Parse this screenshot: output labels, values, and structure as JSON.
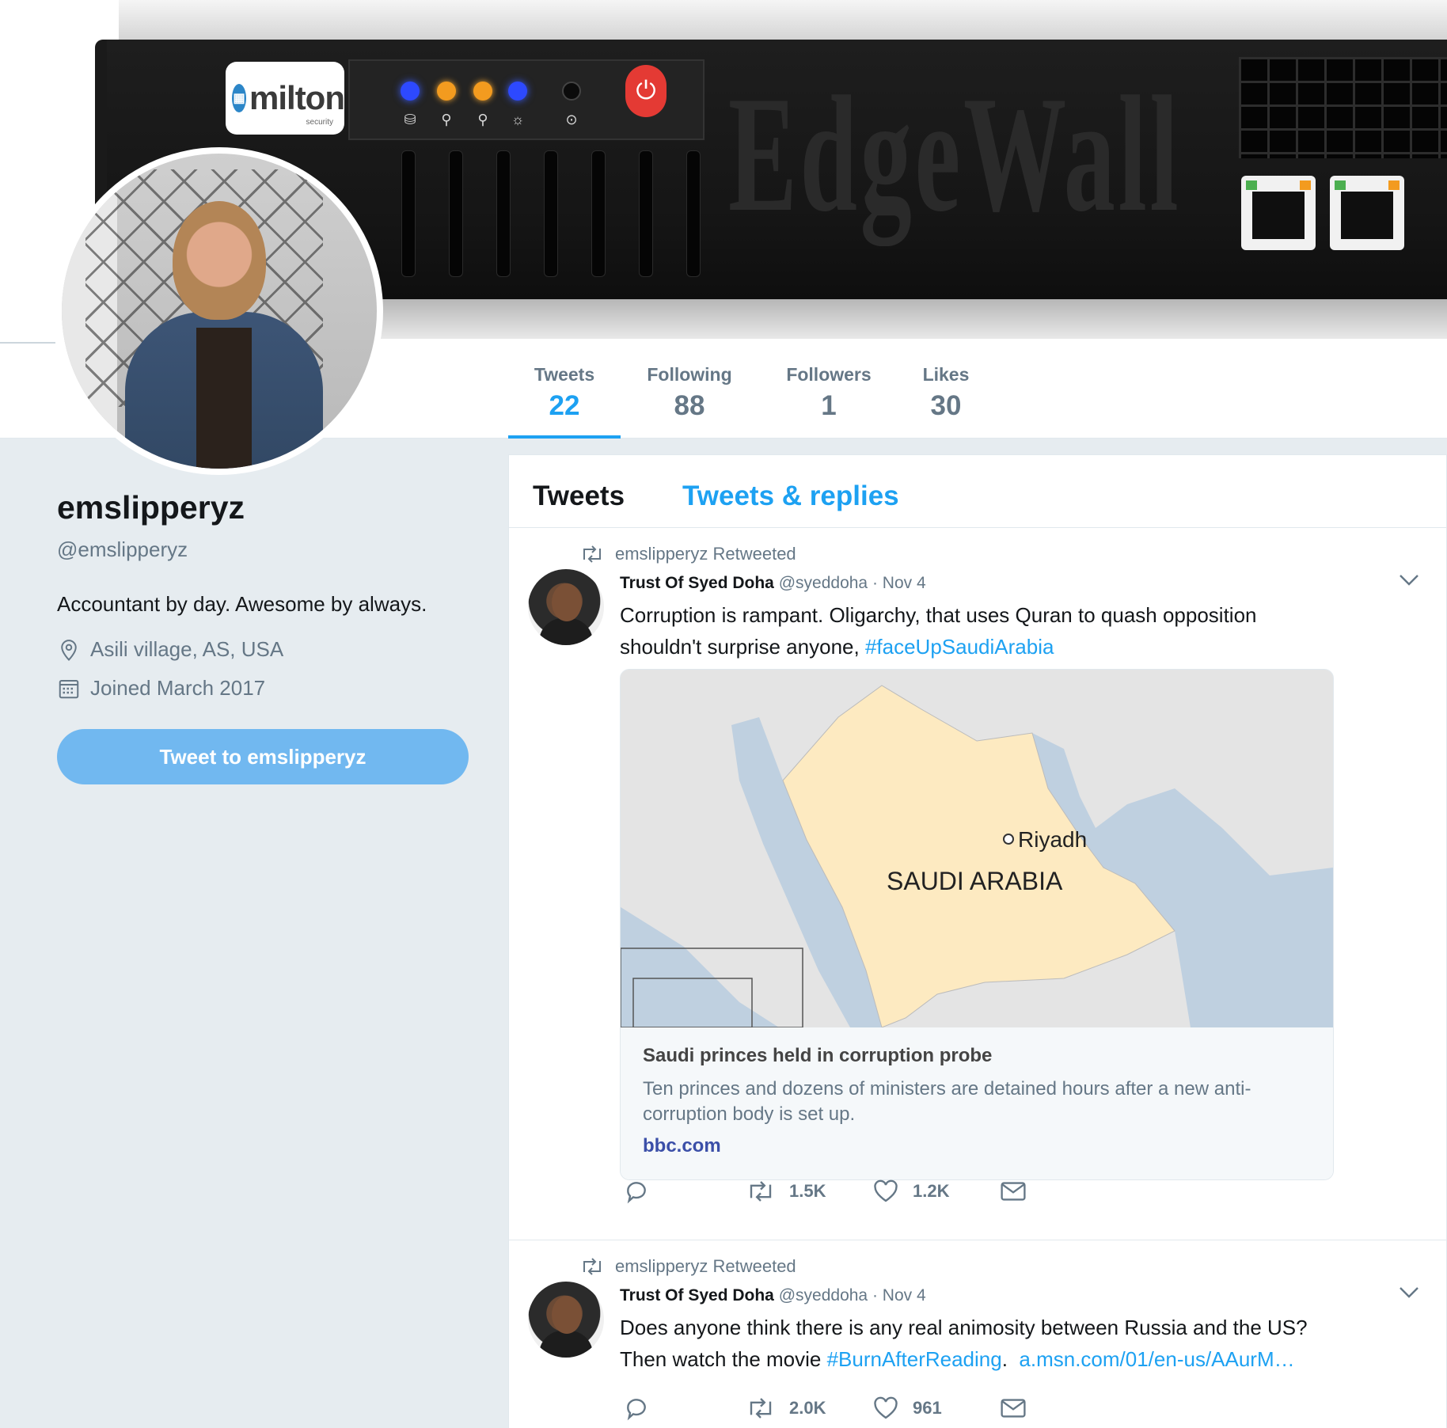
{
  "banner": {
    "logo_text": "milton",
    "logo_sub": "security",
    "brand_word": "EdgeWall"
  },
  "nav": {
    "stats": [
      {
        "label": "Tweets",
        "value": "22"
      },
      {
        "label": "Following",
        "value": "88"
      },
      {
        "label": "Followers",
        "value": "1"
      },
      {
        "label": "Likes",
        "value": "30"
      }
    ]
  },
  "profile": {
    "display_name": "emslipperyz",
    "screen_name": "@emslipperyz",
    "bio": "Accountant by day. Awesome by always.",
    "location": "Asili village, AS, USA",
    "joined": "Joined March 2017",
    "tweet_to_label": "Tweet to emslipperyz"
  },
  "timeline": {
    "tabs": [
      "Tweets",
      "Tweets & replies"
    ],
    "tweets": [
      {
        "retweet_label": "emslipperyz Retweeted",
        "author": "Trust Of Syed Doha",
        "handle": "@syeddoha",
        "date": "· Nov 4",
        "text_line1": "Corruption is rampant. Oligarchy, that uses Quran to quash opposition",
        "text_line2": "shouldn't surprise anyone, ",
        "hashtag": "#faceUpSaudiArabia",
        "card": {
          "map_labels": {
            "city": "Riyadh",
            "country": "SAUDI ARABIA"
          },
          "title": "Saudi princes held in corruption probe",
          "description": "Ten princes and dozens of ministers are detained hours after a new anti-corruption body is set up.",
          "desc_line1": "Ten princes and dozens of ministers are detained hours after a new anti-",
          "desc_line2": "corruption body is set up.",
          "url": "bbc.com"
        },
        "retweets": "1.5K",
        "likes": "1.2K"
      },
      {
        "retweet_label": "emslipperyz Retweeted",
        "author": "Trust Of Syed Doha",
        "handle": "@syeddoha",
        "date": "· Nov 4",
        "text_line1": "Does anyone think there is any real animosity between Russia and the US?",
        "text_line2": "Then watch the movie ",
        "hashtag": "#BurnAfterReading",
        "link": "a.msn.com/01/en-us/AAurM…",
        "retweets": "2.0K",
        "likes": "961"
      }
    ]
  },
  "colors": {
    "accent": "#1da1f2",
    "secondary_text": "#657786",
    "tweet_to_button": "#71b8f0",
    "map_land": "#fdeac1",
    "map_water": "#bfd0e0"
  }
}
